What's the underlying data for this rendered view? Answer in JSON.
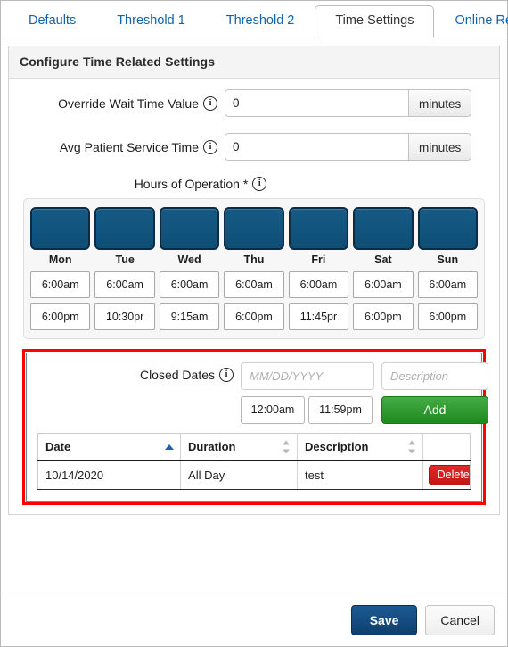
{
  "tabs": [
    {
      "label": "Defaults",
      "active": false
    },
    {
      "label": "Threshold 1",
      "active": false
    },
    {
      "label": "Threshold 2",
      "active": false
    },
    {
      "label": "Time Settings",
      "active": true
    },
    {
      "label": "Online Resv",
      "active": false
    }
  ],
  "panel": {
    "title": "Configure Time Related Settings"
  },
  "fields": {
    "override_wait": {
      "label": "Override Wait Time Value",
      "value": "0",
      "unit": "minutes",
      "info": "info-icon"
    },
    "avg_service": {
      "label": "Avg Patient Service Time",
      "value": "0",
      "unit": "minutes",
      "info": "info-icon"
    }
  },
  "hours_of_operation": {
    "label": "Hours of Operation *",
    "info": "info-icon",
    "days": [
      {
        "name": "Mon",
        "enabled": true,
        "open": "6:00am",
        "close": "6:00pm"
      },
      {
        "name": "Tue",
        "enabled": true,
        "open": "6:00am",
        "close": "10:30pr"
      },
      {
        "name": "Wed",
        "enabled": true,
        "open": "6:00am",
        "close": "9:15am"
      },
      {
        "name": "Thu",
        "enabled": true,
        "open": "6:00am",
        "close": "6:00pm"
      },
      {
        "name": "Fri",
        "enabled": true,
        "open": "6:00am",
        "close": "11:45pr"
      },
      {
        "name": "Sat",
        "enabled": true,
        "open": "6:00am",
        "close": "6:00pm"
      },
      {
        "name": "Sun",
        "enabled": true,
        "open": "6:00am",
        "close": "6:00pm"
      }
    ]
  },
  "closed_dates": {
    "label": "Closed Dates",
    "info": "info-icon",
    "date_placeholder": "MM/DD/YYYY",
    "date_value": "",
    "description_placeholder": "Description",
    "description_value": "",
    "start_time": "12:00am",
    "end_time": "11:59pm",
    "add_label": "Add",
    "highlight_color": "#ff0000",
    "table": {
      "columns": [
        "Date",
        "Duration",
        "Description",
        ""
      ],
      "sorted_column": "Date",
      "sort_direction": "asc",
      "rows": [
        {
          "date": "10/14/2020",
          "duration": "All Day",
          "description": "test",
          "action": "Delete"
        }
      ]
    }
  },
  "footer": {
    "save_label": "Save",
    "cancel_label": "Cancel"
  }
}
